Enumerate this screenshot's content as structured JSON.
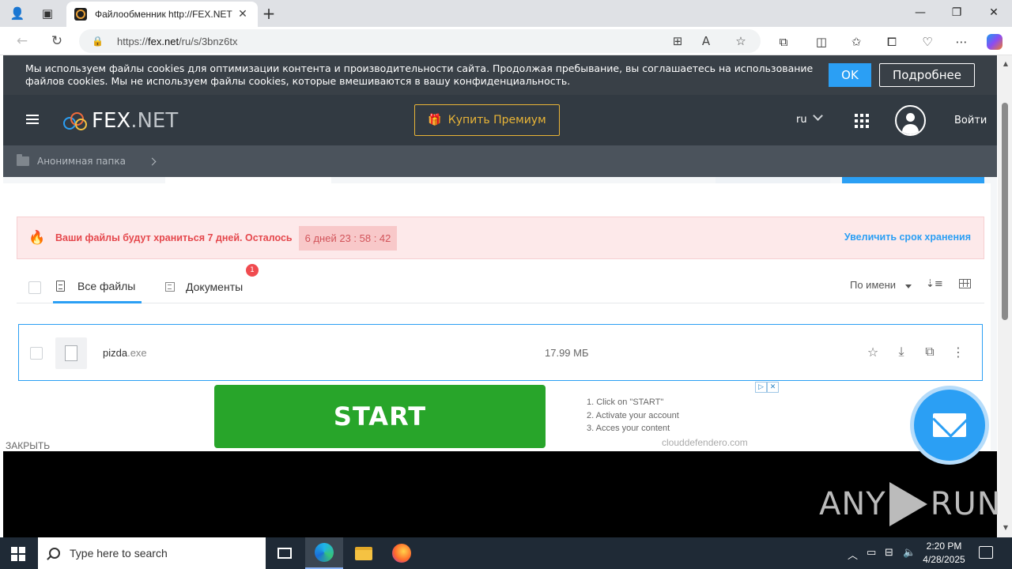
{
  "browser": {
    "tab_title": "Файлообменник http://FEX.NET",
    "url_prefix": "https://",
    "url_host": "fex.net",
    "url_path": "/ru/s/3bnz6tx"
  },
  "cookie_banner": {
    "text": "Мы используем файлы cookies для оптимизации контента и производительности сайта. Продолжая пребывание, вы соглашаетесь на использование файлов cookies. Мы не используем файлы cookies, которые вмешиваются в вашу конфиденциальность.",
    "ok_label": "OK",
    "more_label": "Подробнее"
  },
  "header": {
    "logo_main": "FEX",
    "logo_suffix": ".NET",
    "premium_label": "Купить Премиум",
    "lang": "ru",
    "login_label": "Войти"
  },
  "breadcrumb": {
    "folder": "Анонимная папка"
  },
  "warning": {
    "text": "Ваши файлы будут храниться 7 дней. Осталось",
    "timer": "6 дней  23 : 58 : 42",
    "extend_label": "Увеличить срок хранения"
  },
  "tabs": {
    "all_files": "Все файлы",
    "documents": "Документы",
    "documents_badge": "1",
    "sort_label": "По имени"
  },
  "files": [
    {
      "name": "pizda",
      "ext": ".exe",
      "size": "17.99 МБ"
    }
  ],
  "ad": {
    "start_label": "START",
    "steps": [
      "1. Click on \"START\"",
      "2. Activate your account",
      "3. Acces your content"
    ],
    "domain": "clouddefendero.com",
    "close_label": "ЗАКРЫТЬ"
  },
  "watermark": {
    "left": "ANY",
    "right": "RUN"
  },
  "taskbar": {
    "search_placeholder": "Type here to search",
    "time": "2:20 PM",
    "date": "4/28/2025"
  }
}
